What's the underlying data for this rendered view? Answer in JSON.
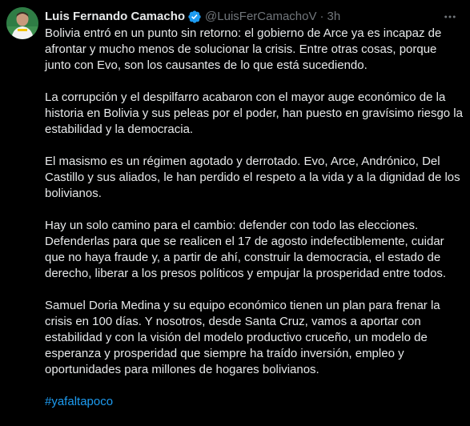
{
  "author": {
    "name": "Luis Fernando Camacho",
    "handle": "@LuisFerCamachoV",
    "separator": "·",
    "time": "3h"
  },
  "icons": {
    "verified": "verified-badge-icon",
    "more": "more-options-icon"
  },
  "colors": {
    "background": "#000000",
    "text": "#e7e9ea",
    "secondary": "#71767b",
    "link": "#1d9bf0"
  },
  "body": {
    "paragraphs": [
      "Bolivia entró en un punto sin retorno: el gobierno de Arce ya es incapaz de afrontar y mucho menos de solucionar la crisis. Entre otras cosas, porque junto con Evo, son los causantes de lo que está sucediendo.",
      "La corrupción y el despilfarro acabaron con el mayor auge económico de la historia en Bolivia y sus peleas por el poder, han puesto en gravísimo riesgo la estabilidad y la democracia.",
      "El masismo es un régimen agotado y  derrotado. Evo, Arce, Andrónico, Del Castillo y sus aliados, le han perdido el respeto a la vida y a la dignidad de los bolivianos.",
      "Hay un solo camino para el cambio: defender con todo las elecciones. Defenderlas para que se realicen el 17 de agosto indefectiblemente, cuidar que no haya fraude y, a partir de ahí, construir la democracia, el estado de derecho, liberar a los presos políticos y empujar la prosperidad entre todos.",
      "Samuel Doria Medina y su equipo económico tienen un plan para frenar la crisis en 100 días. Y nosotros, desde  Santa Cruz, vamos a aportar con estabilidad y con la visión del modelo productivo cruceño, un modelo de esperanza y prosperidad que siempre ha traído inversión, empleo y oportunidades para millones de hogares bolivianos."
    ],
    "hashtag": "#yafaltapoco"
  }
}
